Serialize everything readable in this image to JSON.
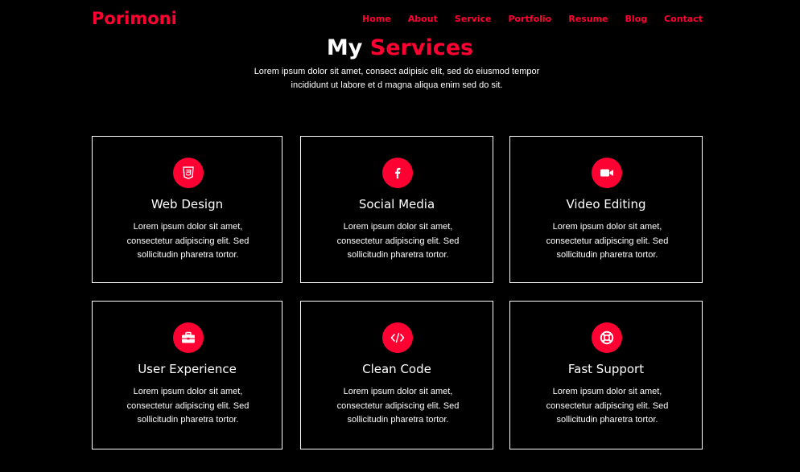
{
  "brand": {
    "logo": "Porimoni"
  },
  "nav": {
    "items": [
      "Home",
      "About",
      "Service",
      "Portfolio",
      "Resume",
      "Blog",
      "Contact"
    ]
  },
  "header": {
    "title_part1": "My",
    "title_part2": "Services",
    "subtitle": "Lorem ipsum dolor sit amet, consect adipisic elit, sed do eiusmod tempor incididunt ut labore et d magna aliqua enim sed do sit."
  },
  "services": [
    {
      "title": "Web Design",
      "icon": "html5-icon",
      "text": "Lorem ipsum dolor sit amet, consectetur adipiscing elit. Sed sollicitudin pharetra tortor."
    },
    {
      "title": "Social Media",
      "icon": "facebook-icon",
      "text": "Lorem ipsum dolor sit amet, consectetur adipiscing elit. Sed sollicitudin pharetra tortor."
    },
    {
      "title": "Video Editing",
      "icon": "video-camera-icon",
      "text": "Lorem ipsum dolor sit amet, consectetur adipiscing elit. Sed sollicitudin pharetra tortor."
    },
    {
      "title": "User Experience",
      "icon": "briefcase-icon",
      "text": "Lorem ipsum dolor sit amet, consectetur adipiscing elit. Sed sollicitudin pharetra tortor."
    },
    {
      "title": "Clean Code",
      "icon": "code-icon",
      "text": "Lorem ipsum dolor sit amet, consectetur adipiscing elit. Sed sollicitudin pharetra tortor."
    },
    {
      "title": "Fast Support",
      "icon": "lifebuoy-icon",
      "text": "Lorem ipsum dolor sit amet, consectetur adipiscing elit. Sed sollicitudin pharetra tortor."
    }
  ],
  "colors": {
    "accent": "#ff0033",
    "background": "#000000",
    "text": "#ffffff"
  }
}
